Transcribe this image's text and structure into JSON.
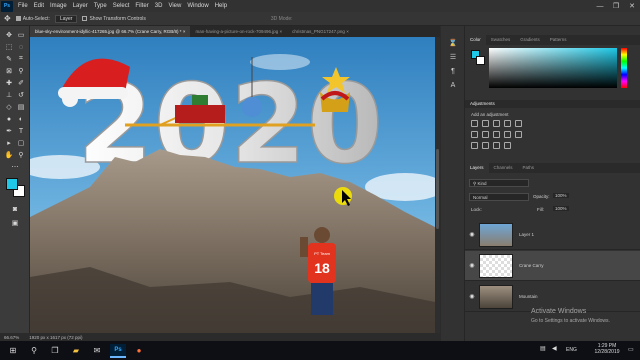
{
  "menubar": {
    "app_logo": "Ps",
    "items": [
      "File",
      "Edit",
      "Image",
      "Layer",
      "Type",
      "Select",
      "Filter",
      "3D",
      "View",
      "Window",
      "Help"
    ],
    "window_controls": {
      "minimize": "—",
      "maximize": "❐",
      "close": "✕"
    }
  },
  "options_bar": {
    "move_icon": "✥",
    "auto_select_label": "Auto-Select:",
    "auto_select_value": "Layer",
    "transform_label": "Show Transform Controls",
    "mode_label": "3D Mode:"
  },
  "document_tabs": [
    {
      "label": "blue-sky-environment-idyllic-417265.jpg @ 66.7% (Crane Carry, RGB/8) *",
      "close": "×"
    },
    {
      "label": "man-having-a-picture-on-rock-709496.jpg",
      "close": "×"
    },
    {
      "label": "christmas_PNG17247.png",
      "close": "×"
    }
  ],
  "canvas": {
    "headline": "2020",
    "shirt_number": "18",
    "shirt_text": "PT Team"
  },
  "statusbar": {
    "zoom": "66.67%",
    "doc_size": "1920 px x 1617 px (72 ppi)"
  },
  "panels": {
    "color_tabs": [
      "Color",
      "Swatches",
      "Gradients",
      "Patterns"
    ],
    "adjustments_title": "Adjustments",
    "add_adjustment": "Add an adjustment",
    "layers_tabs": [
      "Layers",
      "Channels",
      "Paths"
    ],
    "kind_label": "Kind",
    "blend_mode": "Normal",
    "opacity_label": "Opacity:",
    "opacity_value": "100%",
    "lock_label": "Lock:",
    "fill_label": "Fill:",
    "fill_value": "100%",
    "layers": [
      {
        "name": "Layer 1",
        "visible": true,
        "selected": false
      },
      {
        "name": "Crane Carry",
        "visible": true,
        "selected": true
      },
      {
        "name": "Mountain",
        "visible": true,
        "selected": false
      }
    ]
  },
  "activation": {
    "title": "Activate Windows",
    "subtitle": "Go to Settings to activate Windows."
  },
  "taskbar": {
    "language": "ENG",
    "time": "1:29 PM",
    "date": "12/28/2019"
  },
  "colors": {
    "foreground": "#1ec8e6",
    "background": "#ffffff",
    "accent": "#31a8ff"
  }
}
